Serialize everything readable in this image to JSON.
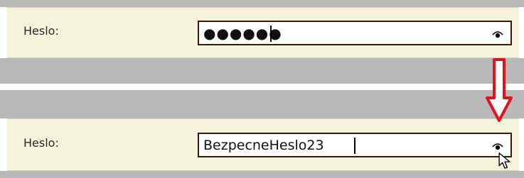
{
  "top": {
    "label": "Heslo:",
    "password_masked": "●●●●●●",
    "reveal_icon": "eye-icon"
  },
  "bottom": {
    "label": "Heslo:",
    "password_revealed": "BezpecneHeslo23",
    "reveal_icon": "eye-icon"
  },
  "annotation": {
    "arrow_icon": "down-arrow-icon",
    "arrow_color": "#e0141e"
  },
  "colors": {
    "row_background": "#f5f2dc",
    "separator_gray": "#b8b8b8",
    "field_border": "#3a1a10"
  }
}
